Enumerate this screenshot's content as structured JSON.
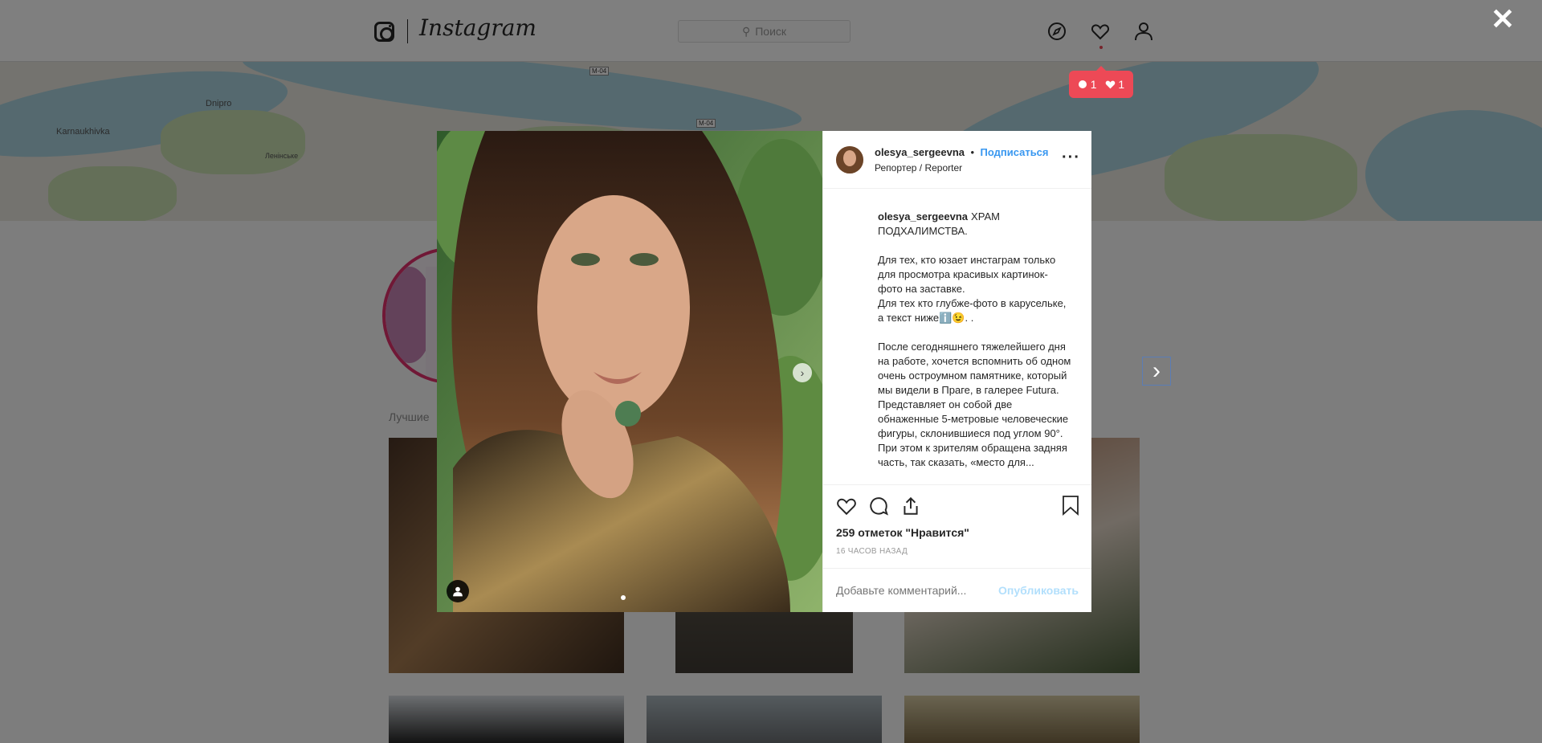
{
  "header": {
    "brand": "Instagram",
    "search_placeholder": "Поиск",
    "notif_comments": "1",
    "notif_likes": "1"
  },
  "map": {
    "labels": [
      "Karnaukhivka",
      "Dnipro",
      "Ленінське",
      "М-04",
      "М-04"
    ]
  },
  "background": {
    "best_label": "Лучшие"
  },
  "post": {
    "username": "olesya_sergeevna",
    "separator": "•",
    "follow": "Подписаться",
    "location": "Репортер / Reporter",
    "caption": {
      "title": "ХРАМ ПОДХАЛИМСТВА.",
      "p1": "Для тех, кто юзает инстаграм только для просмотра красивых картинок- фото на заставке.",
      "p1b": "Для тех кто глубже-фото в карусельке, а текст ниже",
      "p1c": "ℹ️😉. .",
      "p2": "После сегодняшнего тяжелейшего дня на работе, хочется вспомнить об одном очень остроумном памятнике, который мы видели в Праге, в галерее Futura. Представляет он собой две обнаженные 5-метровые человеческие фигуры, склонившиеся под углом 90°. При этом к зрителям обращена задняя часть, так сказать, «место для..."
    },
    "likes": "259 отметок \"Нравится\"",
    "time": "16 часов назад",
    "comment_placeholder": "Добавьте комментарий...",
    "publish": "Опубликовать"
  },
  "icons": {
    "close": "close-icon",
    "explore": "compass-icon",
    "activity": "heart-icon",
    "profile": "user-icon"
  }
}
